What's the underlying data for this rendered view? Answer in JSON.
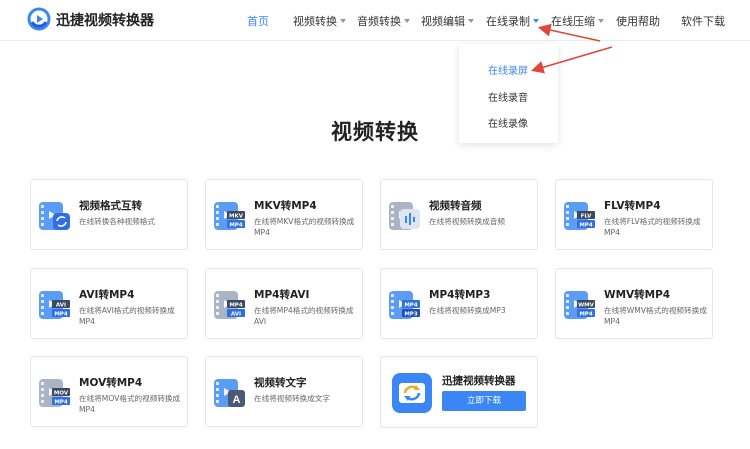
{
  "header": {
    "brand": "迅捷视频转换器",
    "nav": [
      {
        "label": "首页",
        "active": true,
        "caret": false
      },
      {
        "label": "视频转换",
        "active": false,
        "caret": true
      },
      {
        "label": "音频转换",
        "active": false,
        "caret": true
      },
      {
        "label": "视频编辑",
        "active": false,
        "caret": true
      },
      {
        "label": "在线录制",
        "active": false,
        "caret": true,
        "open": true
      },
      {
        "label": "在线压缩",
        "active": false,
        "caret": true
      },
      {
        "label": "使用帮助",
        "active": false,
        "caret": false
      },
      {
        "label": "软件下载",
        "active": false,
        "caret": false
      }
    ]
  },
  "dropdown": {
    "items": [
      "在线录屏",
      "在线录音",
      "在线录像"
    ],
    "active_index": 0
  },
  "main": {
    "title": "视频转换",
    "cards": [
      {
        "title": "视频格式互转",
        "desc": "在线转换各种视频格式",
        "icon": "video-convert-icon",
        "badge_top": "",
        "badge_bottom": ""
      },
      {
        "title": "MKV转MP4",
        "desc": "在线将MKV格式的视频转换成MP4",
        "icon": "mkv-to-mp4-icon",
        "badge_top": "MKV",
        "badge_bottom": "MP4"
      },
      {
        "title": "视频转音频",
        "desc": "在线将视频转换成音频",
        "icon": "video-to-audio-icon",
        "badge_top": "",
        "badge_bottom": ""
      },
      {
        "title": "FLV转MP4",
        "desc": "在线将FLV格式的视频转换成MP4",
        "icon": "flv-to-mp4-icon",
        "badge_top": "FLV",
        "badge_bottom": "MP4"
      },
      {
        "title": "AVI转MP4",
        "desc": "在线将AVI格式的视频转换成MP4",
        "icon": "avi-to-mp4-icon",
        "badge_top": "AVI",
        "badge_bottom": "MP4"
      },
      {
        "title": "MP4转AVI",
        "desc": "在线将MP4格式的视频转换成AVI",
        "icon": "mp4-to-avi-icon",
        "badge_top": "MP4",
        "badge_bottom": "AVI"
      },
      {
        "title": "MP4转MP3",
        "desc": "在线将视频转换成MP3",
        "icon": "mp4-to-mp3-icon",
        "badge_top": "MP4",
        "badge_bottom": "MP3"
      },
      {
        "title": "WMV转MP4",
        "desc": "在线将WMV格式的视频转换成MP4",
        "icon": "wmv-to-mp4-icon",
        "badge_top": "WMV",
        "badge_bottom": "MP4"
      },
      {
        "title": "MOV转MP4",
        "desc": "在线将MOV格式的视频转换成MP4",
        "icon": "mov-to-mp4-icon",
        "badge_top": "MOV",
        "badge_bottom": "MP4"
      },
      {
        "title": "视频转文字",
        "desc": "在线将视频转换成文字",
        "icon": "video-to-text-icon",
        "badge_top": "",
        "badge_bottom": "A"
      }
    ],
    "promo": {
      "title": "迅捷视频转换器",
      "button": "立即下载",
      "icon": "app-logo-icon"
    }
  },
  "colors": {
    "accent": "#3b86f5",
    "annotation_arrow": "#e0463a"
  }
}
